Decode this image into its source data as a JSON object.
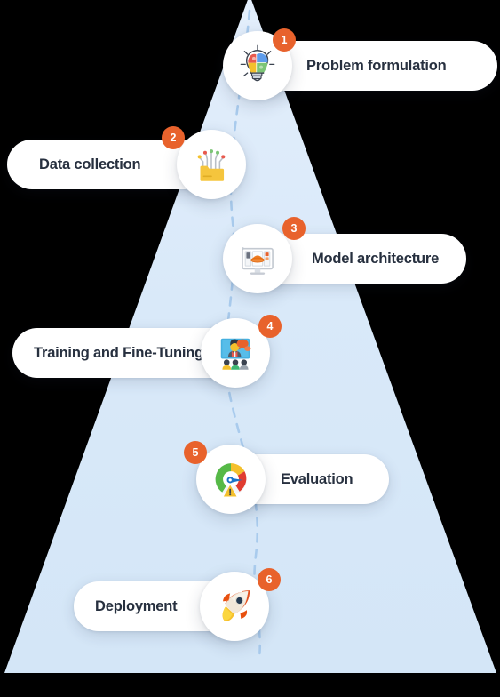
{
  "diagram": {
    "title": "Machine learning lifecycle pyramid",
    "background_color": "#000000",
    "pyramid_color": "#d6e7f7",
    "badge_color": "#e8622c",
    "pill_color": "#ffffff",
    "label_color": "#27303f",
    "path_style": "dashed",
    "path_color": "#a9cbed"
  },
  "steps": [
    {
      "number": "1",
      "label": "Problem formulation",
      "icon": "lightbulb-puzzle-icon",
      "side": "right",
      "colors": [
        "#e8594e",
        "#5d9cec",
        "#7cc576",
        "#f4c02c"
      ]
    },
    {
      "number": "2",
      "label": "Data collection",
      "icon": "folder-circuit-icon",
      "side": "left",
      "colors": [
        "#f4c430",
        "#e8594e",
        "#7cc576",
        "#f4c02c"
      ]
    },
    {
      "number": "3",
      "label": "Model architecture",
      "icon": "monitor-model-icon",
      "side": "right",
      "colors": [
        "#ef7d22",
        "#e8622c",
        "#cfd6de"
      ]
    },
    {
      "number": "4",
      "label": "Training and Fine-Tuning",
      "icon": "video-training-icon",
      "side": "left",
      "colors": [
        "#44b0e0",
        "#f4c430",
        "#3fb873",
        "#9aa3ad"
      ]
    },
    {
      "number": "5",
      "label": "Evaluation",
      "icon": "gauge-warning-icon",
      "side": "right",
      "colors": [
        "#56b947",
        "#f4c02c",
        "#e03c31",
        "#1a73c8"
      ]
    },
    {
      "number": "6",
      "label": "Deployment",
      "icon": "rocket-icon",
      "side": "left",
      "colors": [
        "#ea5b26",
        "#f0f0ea",
        "#fbc02d",
        "#1f3a5f"
      ]
    }
  ]
}
